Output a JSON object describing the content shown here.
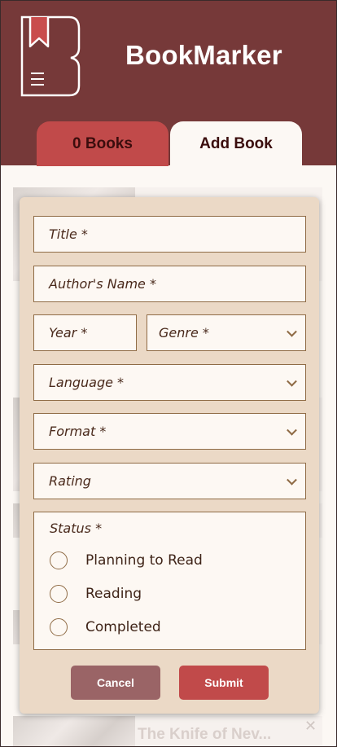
{
  "app": {
    "title": "BookMarker"
  },
  "tabs": [
    {
      "label": "0 Books",
      "active": false
    },
    {
      "label": "Add Book",
      "active": true
    }
  ],
  "background_list": {
    "visible_book_title": "The Knife of Nev...",
    "close_glyph": "✕"
  },
  "form": {
    "title_placeholder": "Title *",
    "author_placeholder": "Author's Name *",
    "year_placeholder": "Year *",
    "genre_placeholder": "Genre *",
    "language_placeholder": "Language *",
    "format_placeholder": "Format *",
    "rating_placeholder": "Rating",
    "status": {
      "label": "Status *",
      "options": [
        "Planning to Read",
        "Reading",
        "Completed"
      ]
    },
    "cancel_label": "Cancel",
    "submit_label": "Submit"
  },
  "colors": {
    "header": "#763939",
    "tab_inactive": "#c14a4a",
    "modal_bg": "#ebd9c6",
    "field_border": "#8f6b45",
    "cancel": "#9a6466",
    "submit": "#c14a4a"
  }
}
